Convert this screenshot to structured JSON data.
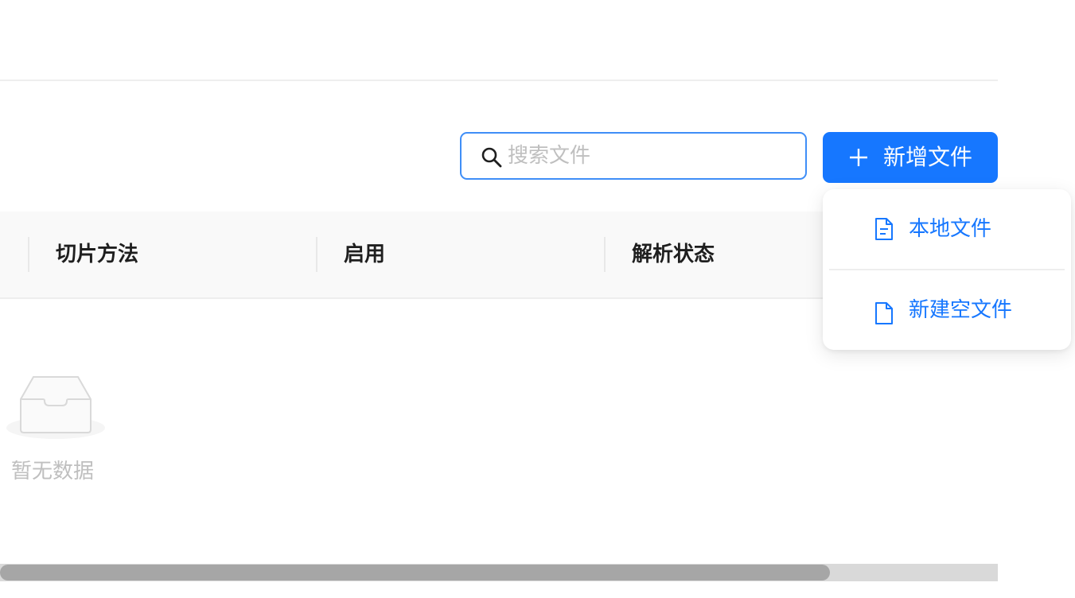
{
  "toolbar": {
    "search_placeholder": "搜索文件",
    "search_value": "",
    "add_button_label": "新增文件"
  },
  "dropdown": {
    "items": [
      {
        "label": "本地文件",
        "icon": "file-text-icon"
      },
      {
        "label": "新建空文件",
        "icon": "file-icon"
      }
    ]
  },
  "table": {
    "columns": [
      "切片方法",
      "启用",
      "解析状态"
    ],
    "empty_text": "暂无数据"
  },
  "scrollbar": {
    "horizontal_position_fraction": 0.0,
    "horizontal_visible_fraction": 0.83
  },
  "colors": {
    "accent": "#1677ff",
    "focus_border": "#3f8ef7",
    "placeholder": "#bfbfbf",
    "header_bg": "#f9f9f9"
  }
}
